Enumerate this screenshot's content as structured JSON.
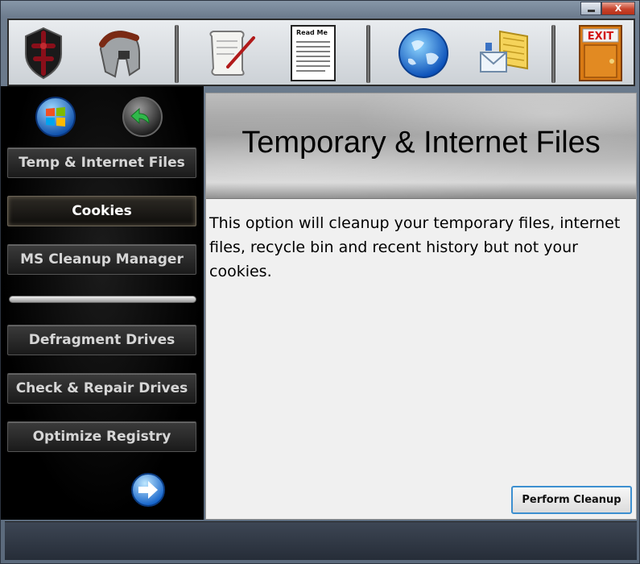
{
  "window": {
    "minimize_icon": "minimize-icon",
    "close_glyph": "X"
  },
  "toolbar": {
    "tools": [
      {
        "icon": "shield-cross-icon"
      },
      {
        "icon": "spartan-helmet-icon"
      },
      {
        "icon": "scroll-quill-icon"
      },
      {
        "icon": "readme-document-icon",
        "label": "Read Me"
      },
      {
        "icon": "globe-icon"
      },
      {
        "icon": "mail-envelope-icon"
      },
      {
        "icon": "exit-door-icon",
        "label": "EXIT"
      }
    ]
  },
  "sidebar": {
    "windows_icon": "windows-logo-icon",
    "back_icon": "back-arrow-icon",
    "next_icon": "forward-arrow-icon",
    "items": [
      {
        "label": "Temp & Internet Files",
        "active": false
      },
      {
        "label": "Cookies",
        "active": true
      },
      {
        "label": "MS Cleanup Manager",
        "active": false
      },
      {
        "label": "Defragment Drives",
        "active": false
      },
      {
        "label": "Check & Repair Drives",
        "active": false
      },
      {
        "label": "Optimize Registry",
        "active": false
      }
    ]
  },
  "content": {
    "title": "Temporary & Internet Files",
    "description": "This option will cleanup your temporary files, internet files, recycle bin and recent history but not your cookies.",
    "action_label": "Perform Cleanup"
  },
  "colors": {
    "accent": "#3c8fd0",
    "sidebar_bg": "#000000",
    "content_bg": "#f0f0f0"
  }
}
